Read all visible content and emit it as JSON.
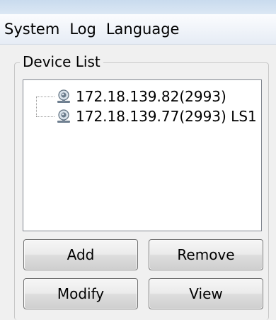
{
  "menu": {
    "items": [
      "System",
      "Log",
      "Language"
    ]
  },
  "device_list": {
    "title": "Device List",
    "devices": [
      {
        "label": "172.18.139.82(2993)",
        "icon": "camera-icon"
      },
      {
        "label": "172.18.139.77(2993) LS1",
        "icon": "camera-icon"
      }
    ]
  },
  "buttons": {
    "add": "Add",
    "remove": "Remove",
    "modify": "Modify",
    "view": "View"
  }
}
